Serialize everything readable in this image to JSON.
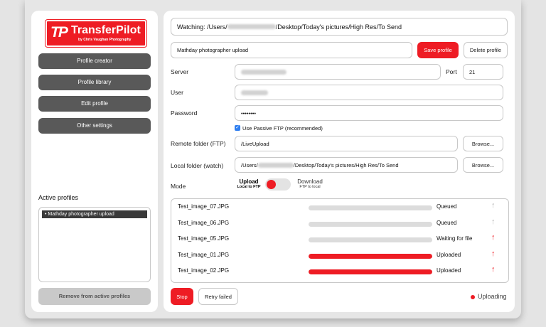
{
  "logo": {
    "mark": "TP",
    "name": "TransferPilot",
    "by": "by Chris Vaughan Photography"
  },
  "nav": [
    {
      "label": "Profile creator"
    },
    {
      "label": "Profile library"
    },
    {
      "label": "Edit profile"
    },
    {
      "label": "Other settings"
    }
  ],
  "active_profiles": {
    "label": "Active profiles",
    "items": [
      "Mathday photographer upload"
    ],
    "remove_label": "Remove from active profiles"
  },
  "watching": {
    "prefix": "Watching: /Users/",
    "suffix": "/Desktop/Today's pictures/High Res/To Send"
  },
  "profile": {
    "name": "Mathday photographer upload",
    "save_label": "Save profile",
    "delete_label": "Delete profile"
  },
  "form": {
    "server_label": "Server",
    "port_label": "Port",
    "port_value": "21",
    "user_label": "User",
    "password_label": "Password",
    "password_value": "••••••••",
    "passive_ftp_label": "Use Passive FTP (recommended)",
    "passive_ftp_checked": true,
    "remote_label": "Remote folder (FTP)",
    "remote_value": "/LiveUpload",
    "local_label": "Local folder (watch)",
    "local_prefix": "/Users/",
    "local_suffix": "/Desktop/Today's pictures/High Res/To Send",
    "browse_label": "Browse..."
  },
  "mode": {
    "label": "Mode",
    "upload": "Upload",
    "upload_sub": "Local to FTP",
    "download": "Download",
    "download_sub": "FTP to local"
  },
  "queue": [
    {
      "name": "Test_image_07.JPG",
      "progress": 0,
      "status": "Queued",
      "arrow": "↑",
      "arrow_color": "#b5b5b5"
    },
    {
      "name": "Test_image_06.JPG",
      "progress": 0,
      "status": "Queued",
      "arrow": "↑",
      "arrow_color": "#b5b5b5"
    },
    {
      "name": "Test_image_05.JPG",
      "progress": 0,
      "status": "Waiting for file",
      "arrow": "↑",
      "arrow_color": "#ee1c24"
    },
    {
      "name": "Test_image_01.JPG",
      "progress": 1,
      "status": "Uploaded",
      "arrow": "↑",
      "arrow_color": "#ee1c24"
    },
    {
      "name": "Test_image_02.JPG",
      "progress": 1,
      "status": "Uploaded",
      "arrow": "↑",
      "arrow_color": "#ee1c24"
    }
  ],
  "footer": {
    "stop_label": "Stop",
    "retry_label": "Retry failed",
    "status": "Uploading"
  },
  "colors": {
    "accent": "#ee1c24",
    "nav_button": "#595959"
  }
}
